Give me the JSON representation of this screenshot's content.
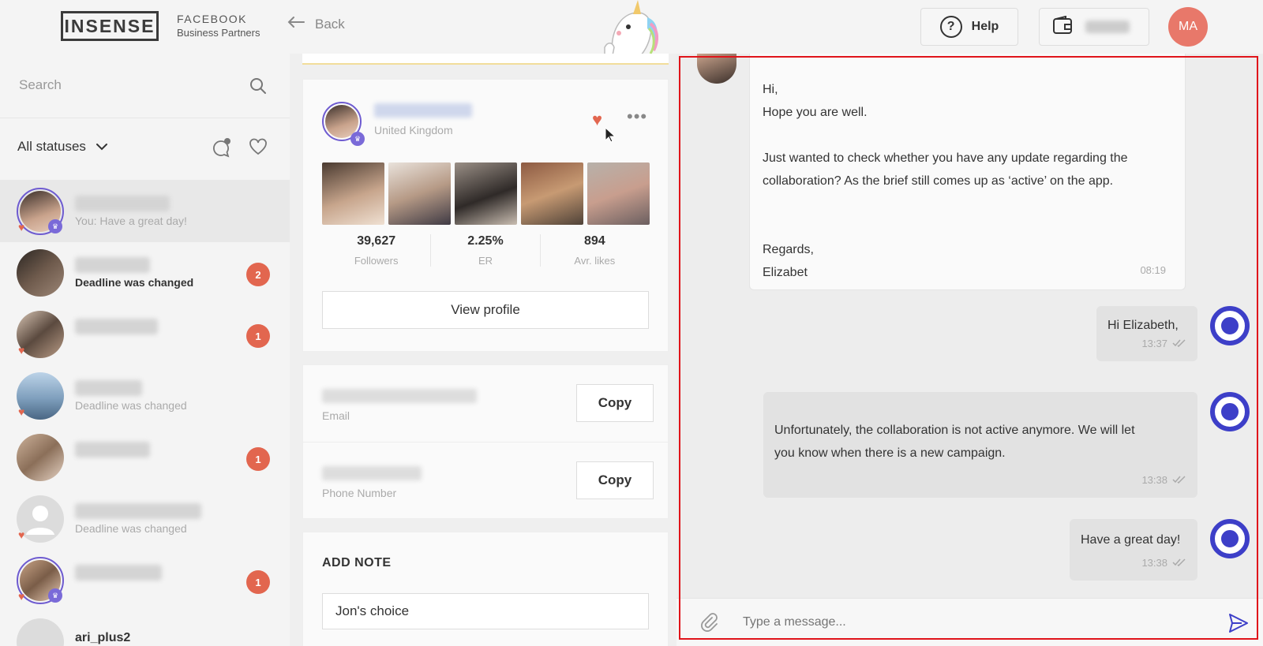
{
  "header": {
    "logo_text": "INSENSE",
    "partner_line1": "FACEBOOK",
    "partner_line2": "Business Partners",
    "back_label": "Back",
    "help_label": "Help",
    "avatar_initials": "MA"
  },
  "sidebar": {
    "search_placeholder": "Search",
    "status_filter": "All statuses",
    "chats": [
      {
        "preview": "You: Have a great day!",
        "unread": "",
        "bold": false
      },
      {
        "preview": "Deadline was changed",
        "unread": "2",
        "bold": true
      },
      {
        "preview": "",
        "unread": "1",
        "bold": false
      },
      {
        "preview": "Deadline was changed",
        "unread": "",
        "bold": false
      },
      {
        "preview": "",
        "unread": "1",
        "bold": false
      },
      {
        "preview": "Deadline was changed",
        "unread": "",
        "bold": false
      },
      {
        "preview": "",
        "unread": "1",
        "bold": false
      },
      {
        "name": "ari_plus2",
        "preview": "",
        "unread": "",
        "bold": false
      }
    ]
  },
  "profile": {
    "country": "United Kingdom",
    "stats": [
      {
        "value": "39,627",
        "label": "Followers"
      },
      {
        "value": "2.25%",
        "label": "ER"
      },
      {
        "value": "894",
        "label": "Avr. likes"
      }
    ],
    "view_profile_label": "View profile",
    "email_label": "Email",
    "phone_label": "Phone Number",
    "copy_label": "Copy",
    "note_title": "ADD NOTE",
    "note_value": "Jon's choice"
  },
  "chat": {
    "incoming": {
      "text": "Hi,\nHope you are well.\n\nJust wanted to check whether you have any update regarding the\ncollaboration? As the brief still comes up as ‘active’ on the app.\n\n\nRegards,\nElizabet",
      "time": "08:19"
    },
    "outgoing": [
      {
        "text": "Hi Elizabeth,",
        "time": "13:37"
      },
      {
        "text": "Unfortunately, the collaboration is not active anymore. We will let\nyou know when there is a new campaign.",
        "time": "13:38"
      },
      {
        "text": "Have a great day!",
        "time": "13:38"
      }
    ],
    "input_placeholder": "Type a message..."
  },
  "colors": {
    "accent": "#e2664f",
    "brand_blue": "#3d3fc8",
    "purple": "#6e5bd0",
    "highlight_border": "#e0141a"
  }
}
